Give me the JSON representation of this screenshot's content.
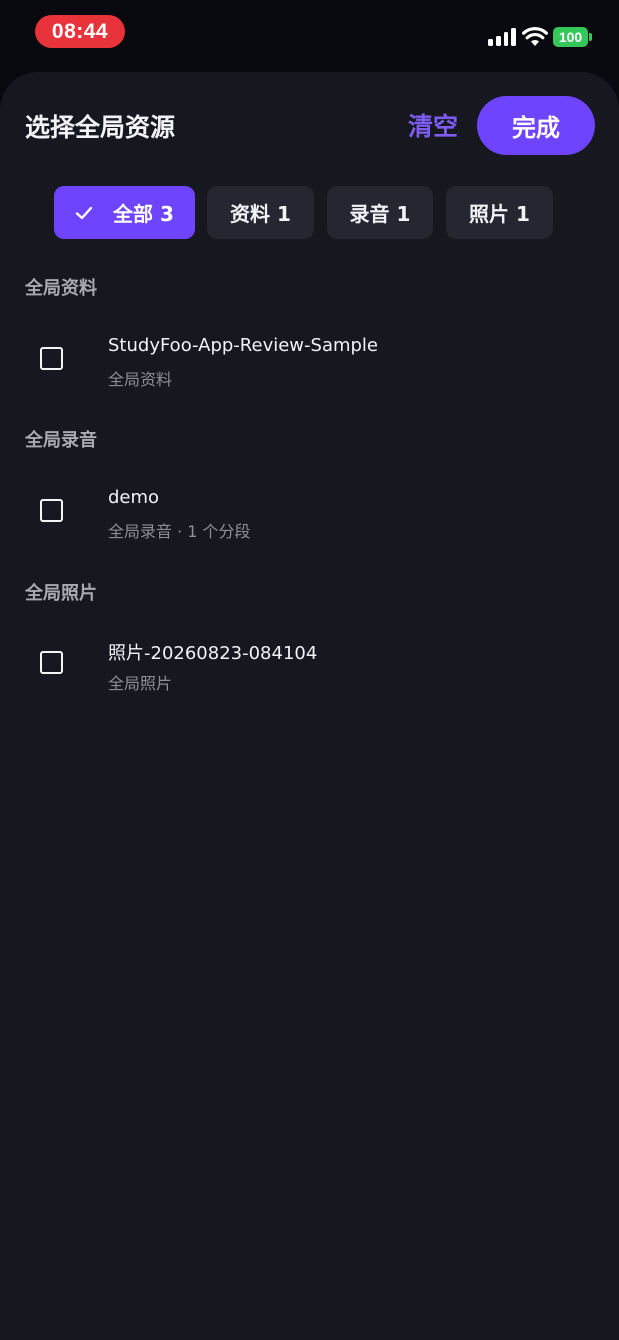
{
  "status_bar": {
    "time": "08:44",
    "battery": "100",
    "icons": [
      "signal-icon",
      "wifi-icon",
      "battery-icon"
    ]
  },
  "sheet": {
    "title": "选择全局资源",
    "clear_label": "清空",
    "done_label": "完成"
  },
  "filters": [
    {
      "label": "全部 3",
      "selected": true,
      "icon": "check-icon"
    },
    {
      "label": "资料 1",
      "selected": false
    },
    {
      "label": "录音 1",
      "selected": false
    },
    {
      "label": "照片 1",
      "selected": false
    }
  ],
  "sections": [
    {
      "header": "全局资料",
      "items": [
        {
          "title": "StudyFoo-App-Review-Sample",
          "subtitle": "全局资料",
          "checked": false
        }
      ]
    },
    {
      "header": "全局录音",
      "items": [
        {
          "title": "demo",
          "subtitle": "全局录音 · 1 个分段",
          "checked": false
        }
      ]
    },
    {
      "header": "全局照片",
      "items": [
        {
          "title": "照片-20260823-084104",
          "subtitle": "全局照片",
          "checked": false
        }
      ]
    }
  ],
  "colors": {
    "accent": "#6e44ff",
    "accent_text": "#7c5cf2",
    "sheet_background": "#17171f",
    "chip_background": "#262631",
    "recording_pill": "#e8333b",
    "battery": "#34c759"
  }
}
